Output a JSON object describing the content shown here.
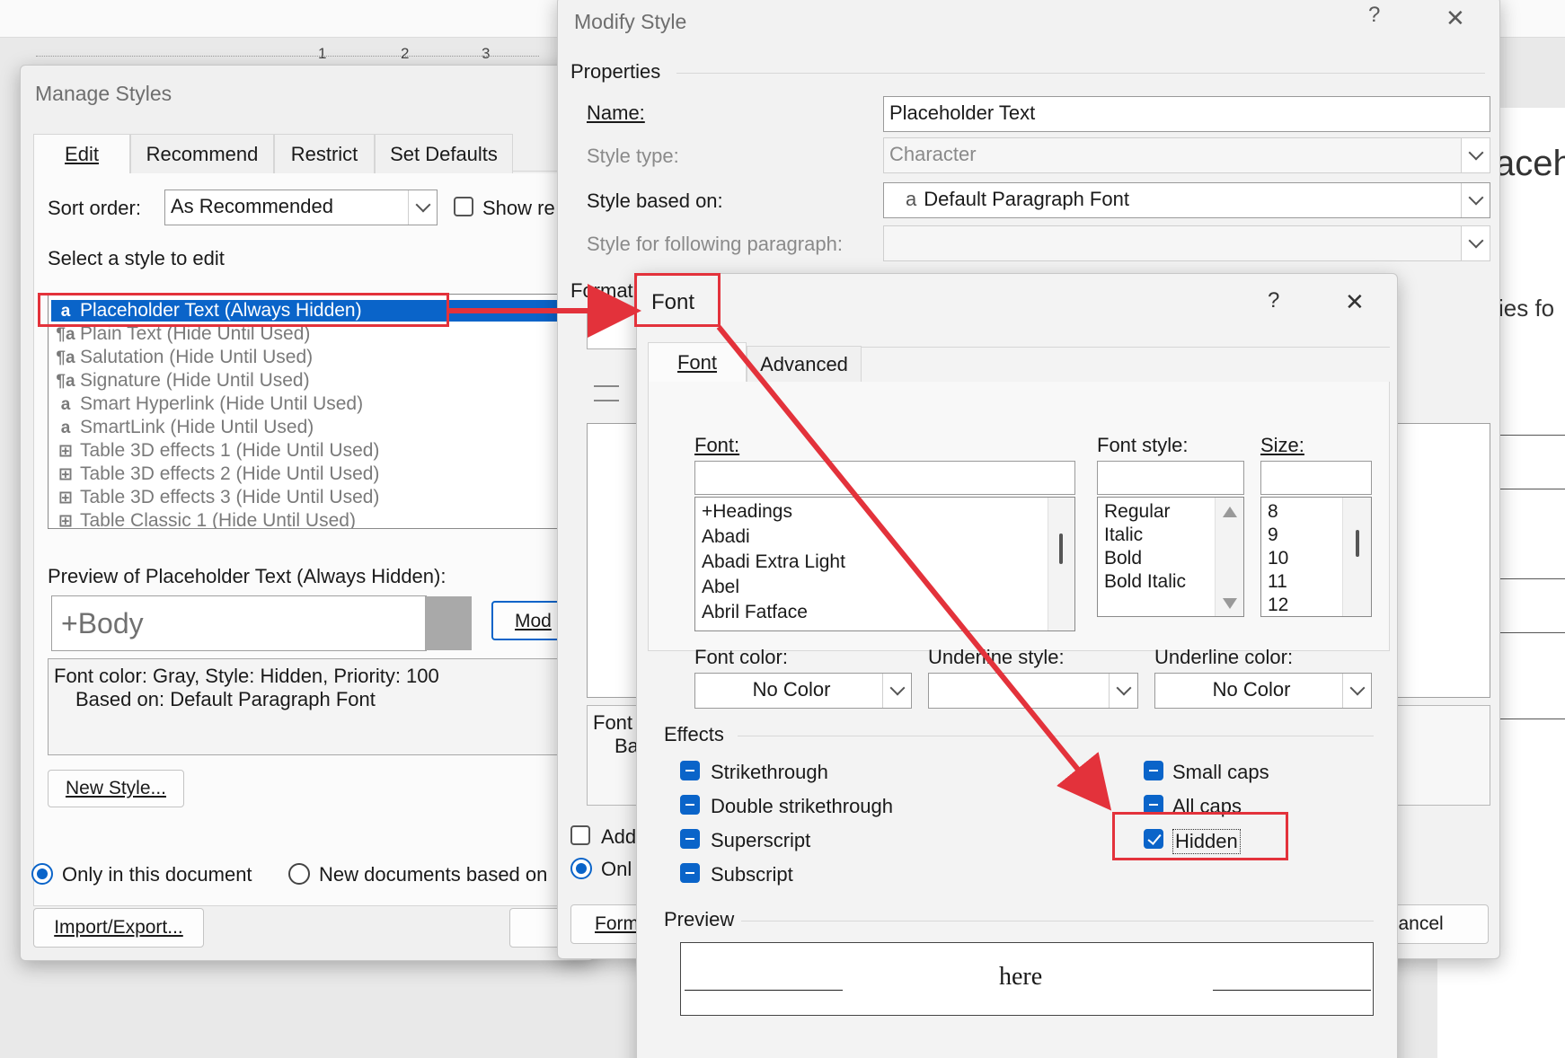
{
  "ruler": {
    "marks": [
      "1",
      "2",
      "3"
    ]
  },
  "background": {
    "heading_fragment": "aceh",
    "text_fragment": "ies fo"
  },
  "manage": {
    "title": "Manage Styles",
    "tabs": [
      "Edit",
      "Recommend",
      "Restrict",
      "Set Defaults"
    ],
    "sort_label": "Sort order:",
    "sort_value": "As Recommended",
    "show_label": "Show re",
    "select_label": "Select a style to edit",
    "styles": [
      {
        "icon": "a",
        "text": "Placeholder Text  (Always Hidden)"
      },
      {
        "icon": "¶a",
        "text": "Plain Text  (Hide Until Used)"
      },
      {
        "icon": "¶a",
        "text": "Salutation  (Hide Until Used)"
      },
      {
        "icon": "¶a",
        "text": "Signature  (Hide Until Used)"
      },
      {
        "icon": "a",
        "text": "Smart Hyperlink  (Hide Until Used)"
      },
      {
        "icon": "a",
        "text": "SmartLink  (Hide Until Used)"
      },
      {
        "icon": "⊞",
        "text": "Table 3D effects 1  (Hide Until Used)"
      },
      {
        "icon": "⊞",
        "text": "Table 3D effects 2  (Hide Until Used)"
      },
      {
        "icon": "⊞",
        "text": "Table 3D effects 3  (Hide Until Used)"
      },
      {
        "icon": "⊞",
        "text": "Table Classic 1  (Hide Until Used)"
      }
    ],
    "preview_label": "Preview of Placeholder Text  (Always Hidden):",
    "preview_text": "+Body",
    "modify_button": "Mod",
    "description_line1": "Font color: Gray, Style: Hidden, Priority: 100",
    "description_line2": "Based on: Default Paragraph Font",
    "new_style_button": "New Style...",
    "radio_only": "Only in this document",
    "radio_new": "New documents based on",
    "import_button": "Import/Export..."
  },
  "modify": {
    "title": "Modify Style",
    "help": "?",
    "close": "✕",
    "properties": "Properties",
    "name_label": "Name:",
    "name_value": "Placeholder Text",
    "type_label": "Style type:",
    "type_value": "Character",
    "based_label": "Style based on:",
    "based_value": "Default Paragraph Font",
    "based_icon": "a",
    "following_label": "Style for following paragraph:",
    "following_value": "",
    "formatting": "Format",
    "desc_frag1": "Font",
    "desc_frag2": "Ba",
    "add_check": "Add",
    "only_radio": "Onl",
    "format_button": "Form",
    "cancel_button": "Cancel"
  },
  "font": {
    "title": "Font",
    "help": "?",
    "close": "✕",
    "tabs": [
      "Font",
      "Advanced"
    ],
    "font_label": "Font:",
    "font_value": "",
    "fonts": [
      "+Headings",
      "Abadi",
      "Abadi Extra Light",
      "Abel",
      "Abril Fatface"
    ],
    "style_label": "Font style:",
    "style_value": "",
    "styles": [
      "Regular",
      "Italic",
      "Bold",
      "Bold Italic"
    ],
    "size_label": "Size:",
    "size_value": "",
    "sizes": [
      "8",
      "9",
      "10",
      "11",
      "12"
    ],
    "color_label": "Font color:",
    "color_value": "No Color",
    "underline_label": "Underline style:",
    "underline_value": "",
    "ucolor_label": "Underline color:",
    "ucolor_value": "No Color",
    "effects_label": "Effects",
    "effects": [
      {
        "label": "Strikethrough",
        "state": "indeterminate"
      },
      {
        "label": "Double strikethrough",
        "state": "indeterminate"
      },
      {
        "label": "Superscript",
        "state": "indeterminate"
      },
      {
        "label": "Subscript",
        "state": "indeterminate"
      },
      {
        "label": "Small caps",
        "state": "indeterminate"
      },
      {
        "label": "All caps",
        "state": "indeterminate"
      },
      {
        "label": "Hidden",
        "state": "checked"
      }
    ],
    "preview_label": "Preview",
    "preview_text": "here"
  },
  "colors": {
    "accent": "#0a64c9",
    "annotation": "#e3323b"
  }
}
